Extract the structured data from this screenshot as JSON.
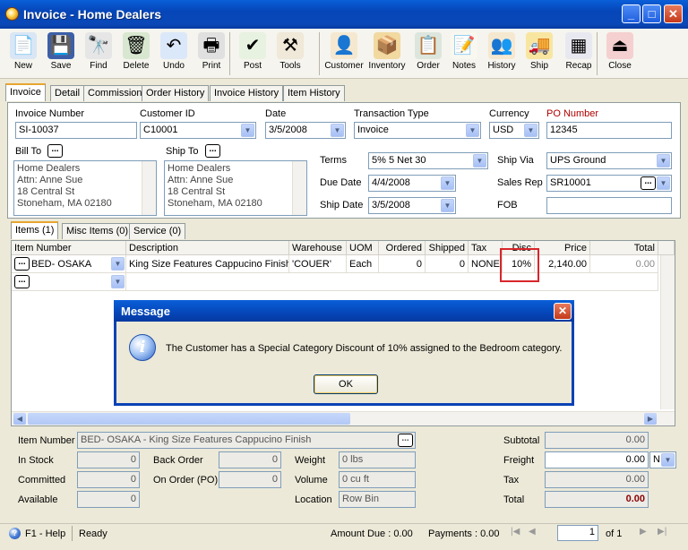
{
  "window": {
    "title": "Invoice - Home Dealers",
    "min": "_",
    "max": "□",
    "close": "✕"
  },
  "toolbar": [
    {
      "key": "new",
      "label": "New",
      "color": "#d9e6f5",
      "glyph": "📄"
    },
    {
      "key": "save",
      "label": "Save",
      "color": "#3d5fa8",
      "glyph": "💾"
    },
    {
      "key": "find",
      "label": "Find",
      "color": "#e6e6e6",
      "glyph": "🔭"
    },
    {
      "key": "delete",
      "label": "Delete",
      "color": "#d8e8d0",
      "glyph": "🗑"
    },
    {
      "key": "undo",
      "label": "Undo",
      "color": "#dbe8fa",
      "glyph": "↶"
    },
    {
      "key": "print",
      "label": "Print",
      "color": "#e0e0e0",
      "glyph": "🖶"
    },
    {
      "key": "post",
      "label": "Post",
      "color": "#e7f2e1",
      "glyph": "✔"
    },
    {
      "key": "tools",
      "label": "Tools",
      "color": "#f0e8d8",
      "glyph": "⚒"
    },
    {
      "key": "customer",
      "label": "Customer",
      "color": "#f5e8d0",
      "glyph": "👤"
    },
    {
      "key": "inventory",
      "label": "Inventory",
      "color": "#f1d9a0",
      "glyph": "📦"
    },
    {
      "key": "order",
      "label": "Order",
      "color": "#dde6dd",
      "glyph": "📋"
    },
    {
      "key": "notes",
      "label": "Notes",
      "color": "#f8f8f0",
      "glyph": "📝"
    },
    {
      "key": "history",
      "label": "History",
      "color": "#f5e8d0",
      "glyph": "👥"
    },
    {
      "key": "ship",
      "label": "Ship",
      "color": "#f8e6a0",
      "glyph": "🚚"
    },
    {
      "key": "recap",
      "label": "Recap",
      "color": "#e8e8f0",
      "glyph": "▦"
    },
    {
      "key": "close",
      "label": "Close",
      "color": "#f5d0d0",
      "glyph": "⏏"
    }
  ],
  "tabs": [
    "Invoice",
    "Detail",
    "Commission",
    "Order History",
    "Invoice History",
    "Item History"
  ],
  "header": {
    "invoice_number_label": "Invoice Number",
    "invoice_number": "SI-10037",
    "customer_id_label": "Customer ID",
    "customer_id": "C10001",
    "date_label": "Date",
    "date": "3/5/2008",
    "transaction_type_label": "Transaction Type",
    "transaction_type": "Invoice",
    "currency_label": "Currency",
    "currency": "USD",
    "po_number_label": "PO Number",
    "po_number": "12345",
    "bill_to_label": "Bill To",
    "ship_to_label": "Ship To",
    "bill_to": [
      "Home Dealers",
      "Attn: Anne Sue",
      "18 Central St",
      "Stoneham, MA 02180"
    ],
    "ship_to": [
      "Home Dealers",
      "Attn: Anne Sue",
      "18 Central St",
      "Stoneham, MA 02180"
    ],
    "terms_label": "Terms",
    "terms": "5% 5 Net 30",
    "due_date_label": "Due Date",
    "due_date": "4/4/2008",
    "ship_date_label": "Ship Date",
    "ship_date": "3/5/2008",
    "ship_via_label": "Ship Via",
    "ship_via": "UPS Ground",
    "sales_rep_label": "Sales Rep",
    "sales_rep": "SR10001",
    "fob_label": "FOB",
    "fob": ""
  },
  "item_tabs": [
    "Items (1)",
    "Misc Items (0)",
    "Service (0)"
  ],
  "grid": {
    "columns": [
      "Item Number",
      "Description",
      "Warehouse",
      "UOM",
      "Ordered",
      "Shipped",
      "Tax",
      "Disc",
      "Price",
      "Total"
    ],
    "rows": [
      [
        "BED- OSAKA",
        "King Size Features Cappucino Finish",
        "'COUER'",
        "Each",
        "0",
        "0",
        "NONE",
        "10%",
        "2,140.00",
        "0.00"
      ]
    ]
  },
  "dialog": {
    "title": "Message",
    "message": "The Customer has a Special Category Discount of 10% assigned to the Bedroom category.",
    "ok": "OK"
  },
  "footer": {
    "item_number_label": "Item Number",
    "item_number": "BED- OSAKA - King Size Features Cappucino Finish",
    "in_stock_label": "In Stock",
    "in_stock": "0",
    "committed_label": "Committed",
    "committed": "0",
    "available_label": "Available",
    "available": "0",
    "back_order_label": "Back Order",
    "back_order": "0",
    "on_order_label": "On Order (PO)",
    "on_order": "0",
    "weight_label": "Weight",
    "weight": "0 lbs",
    "volume_label": "Volume",
    "volume": "0 cu ft",
    "location_label": "Location",
    "location": "Row Bin",
    "subtotal_label": "Subtotal",
    "subtotal": "0.00",
    "freight_label": "Freight",
    "freight": "0.00",
    "freight_code": "N",
    "tax_label": "Tax",
    "tax": "0.00",
    "total_label": "Total",
    "total": "0.00"
  },
  "status": {
    "help": "F1 - Help",
    "state": "Ready",
    "amount_due": "Amount Due : 0.00",
    "payments": "Payments : 0.00",
    "page": "1",
    "of": "of 1"
  }
}
